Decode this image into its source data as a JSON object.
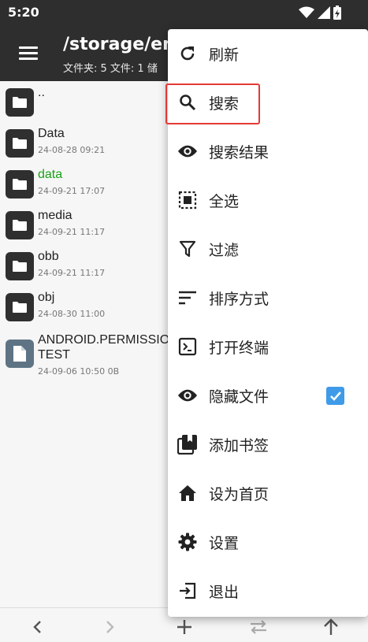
{
  "status_bar": {
    "time": "5:20",
    "icons": [
      "wifi-icon",
      "signal-icon",
      "battery-charging-icon"
    ]
  },
  "toolbar": {
    "path": "/storage/emu",
    "summary": "文件夹: 5  文件: 1  储"
  },
  "files": [
    {
      "name": "..",
      "date": "",
      "icon": "folder-icon",
      "color": "#222222"
    },
    {
      "name": "Data",
      "date": "24-08-28 09:21",
      "icon": "folder-icon",
      "color": "#222222"
    },
    {
      "name": "data",
      "date": "24-09-21 17:07",
      "icon": "folder-icon",
      "color": "#17a117"
    },
    {
      "name": "media",
      "date": "24-09-21 11:17",
      "icon": "folder-icon",
      "color": "#222222"
    },
    {
      "name": "obb",
      "date": "24-09-21 11:17",
      "icon": "folder-icon",
      "color": "#222222"
    },
    {
      "name": "obj",
      "date": "24-08-30 11:00",
      "icon": "folder-icon",
      "color": "#222222"
    },
    {
      "name_line1": "ANDROID.PERMISSION",
      "name_line2": "TEST",
      "date": "24-09-06 10:50  0B",
      "icon": "file-icon"
    }
  ],
  "menu": {
    "items": [
      {
        "label": "刷新",
        "icon": "refresh-icon"
      },
      {
        "label": "搜索",
        "icon": "search-icon",
        "highlighted": true
      },
      {
        "label": "搜索结果",
        "icon": "eye-icon"
      },
      {
        "label": "全选",
        "icon": "select-all-icon"
      },
      {
        "label": "过滤",
        "icon": "filter-icon"
      },
      {
        "label": "排序方式",
        "icon": "sort-icon"
      },
      {
        "label": "打开终端",
        "icon": "terminal-icon"
      },
      {
        "label": "隐藏文件",
        "icon": "eye-icon",
        "checked": true
      },
      {
        "label": "添加书签",
        "icon": "bookmark-icon"
      },
      {
        "label": "设为首页",
        "icon": "home-icon"
      },
      {
        "label": "设置",
        "icon": "gear-icon"
      },
      {
        "label": "退出",
        "icon": "exit-icon"
      }
    ]
  },
  "bottom_bar": {
    "icons": [
      "back-arrow-icon",
      "forward-arrow-icon",
      "add-icon",
      "swap-icon",
      "up-arrow-icon"
    ]
  },
  "colors": {
    "toolbar_bg": "#2e2e2e",
    "highlight_border": "#e53935",
    "checkbox": "#3f9be8",
    "green_folder_text": "#17a117"
  }
}
